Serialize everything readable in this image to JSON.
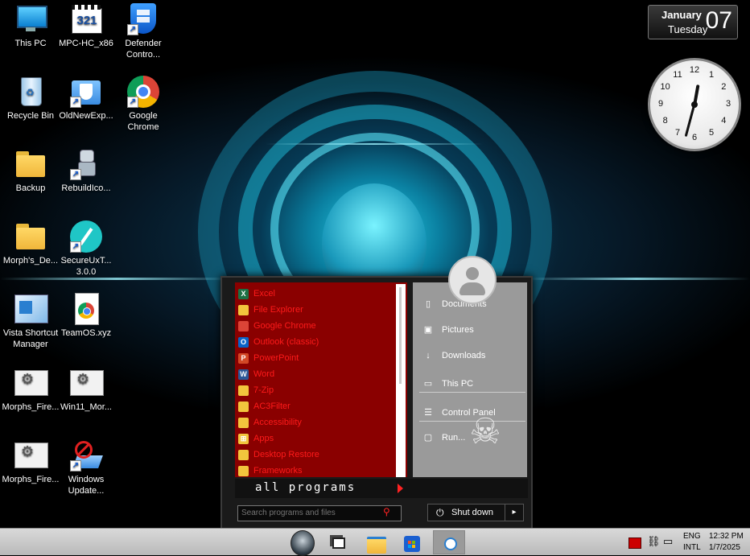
{
  "calendar": {
    "month": "January",
    "weekday": "Tuesday",
    "day": "07"
  },
  "clock": {
    "numbers": [
      "12",
      "1",
      "2",
      "3",
      "4",
      "5",
      "6",
      "7",
      "8",
      "9",
      "10",
      "11"
    ]
  },
  "desktop_icons": [
    {
      "label": "This PC",
      "icon": "this-pc-icon"
    },
    {
      "label": "MPC-HC_x86",
      "icon": "mpc-hc-icon"
    },
    {
      "label": "Defender Contro...",
      "icon": "defender-icon"
    },
    {
      "label": "Recycle Bin",
      "icon": "recycle-bin-icon"
    },
    {
      "label": "OldNewExp...",
      "icon": "oldnewexplorer-icon"
    },
    {
      "label": "Google Chrome",
      "icon": "chrome-icon"
    },
    {
      "label": "Backup",
      "icon": "folder-icon"
    },
    {
      "label": "RebuildIco...",
      "icon": "rebuild-icon"
    },
    {
      "label": "Morph's_De...",
      "icon": "folder-icon"
    },
    {
      "label": "SecureUxT... 3.0.0",
      "icon": "secureux-icon"
    },
    {
      "label": "Vista Shortcut Manager",
      "icon": "vista-shortcut-icon"
    },
    {
      "label": "TeamOS.xyz",
      "icon": "chrome-file-icon"
    },
    {
      "label": "Morphs_Fire...",
      "icon": "settings-file-icon"
    },
    {
      "label": "Win11_Mor...",
      "icon": "settings-file-icon"
    },
    {
      "label": "Morphs_Fire...",
      "icon": "settings-file-icon"
    },
    {
      "label": "Windows Update...",
      "icon": "windows-update-icon"
    }
  ],
  "start_menu": {
    "programs": [
      {
        "label": "Excel",
        "icon": "excel-icon",
        "color": "#1d7044",
        "glyph": "X"
      },
      {
        "label": "File Explorer",
        "icon": "folder-icon",
        "color": "#f2c53d",
        "glyph": ""
      },
      {
        "label": "Google Chrome",
        "icon": "chrome-icon",
        "color": "#db4437",
        "glyph": ""
      },
      {
        "label": "Outlook (classic)",
        "icon": "outlook-icon",
        "color": "#0a64c8",
        "glyph": "O"
      },
      {
        "label": "PowerPoint",
        "icon": "powerpoint-icon",
        "color": "#d24726",
        "glyph": "P"
      },
      {
        "label": "Word",
        "icon": "word-icon",
        "color": "#2b5797",
        "glyph": "W"
      },
      {
        "label": "7-Zip",
        "icon": "folder-icon",
        "color": "#f2c53d",
        "glyph": ""
      },
      {
        "label": "AC3Filter",
        "icon": "folder-icon",
        "color": "#f2c53d",
        "glyph": ""
      },
      {
        "label": "Accessibility",
        "icon": "folder-icon",
        "color": "#f2c53d",
        "glyph": ""
      },
      {
        "label": "Apps",
        "icon": "apps-icon",
        "color": "#f2c53d",
        "glyph": "⊞"
      },
      {
        "label": "Desktop Restore",
        "icon": "folder-icon",
        "color": "#f2c53d",
        "glyph": ""
      },
      {
        "label": "Frameworks",
        "icon": "folder-icon",
        "color": "#f2c53d",
        "glyph": ""
      }
    ],
    "right_items": [
      {
        "label": "Documents",
        "icon": "document-icon",
        "glyph": "▯"
      },
      {
        "label": "Pictures",
        "icon": "picture-icon",
        "glyph": "▣"
      },
      {
        "label": "Downloads",
        "icon": "download-icon",
        "glyph": "↓"
      },
      {
        "label": "This PC",
        "icon": "computer-icon",
        "glyph": "▭"
      },
      {
        "label": "Control Panel",
        "icon": "control-panel-icon",
        "glyph": "☰"
      },
      {
        "label": "Run...",
        "icon": "run-icon",
        "glyph": "▢"
      }
    ],
    "all_programs_label": "all programs",
    "search_placeholder": "Search programs and files",
    "shutdown_label": "Shut down"
  },
  "taskbar": {
    "apps": [
      "start-orb-icon",
      "task-view-icon",
      "file-explorer-icon",
      "store-icon",
      "active-app-icon"
    ],
    "language": "ENG",
    "layout": "INTL",
    "time": "12:32 PM",
    "date": "1/7/2025"
  },
  "colors": {
    "program_bg": "#8a0000",
    "program_text": "#ff1a1a",
    "accent_cyan": "#2ad6ee"
  }
}
